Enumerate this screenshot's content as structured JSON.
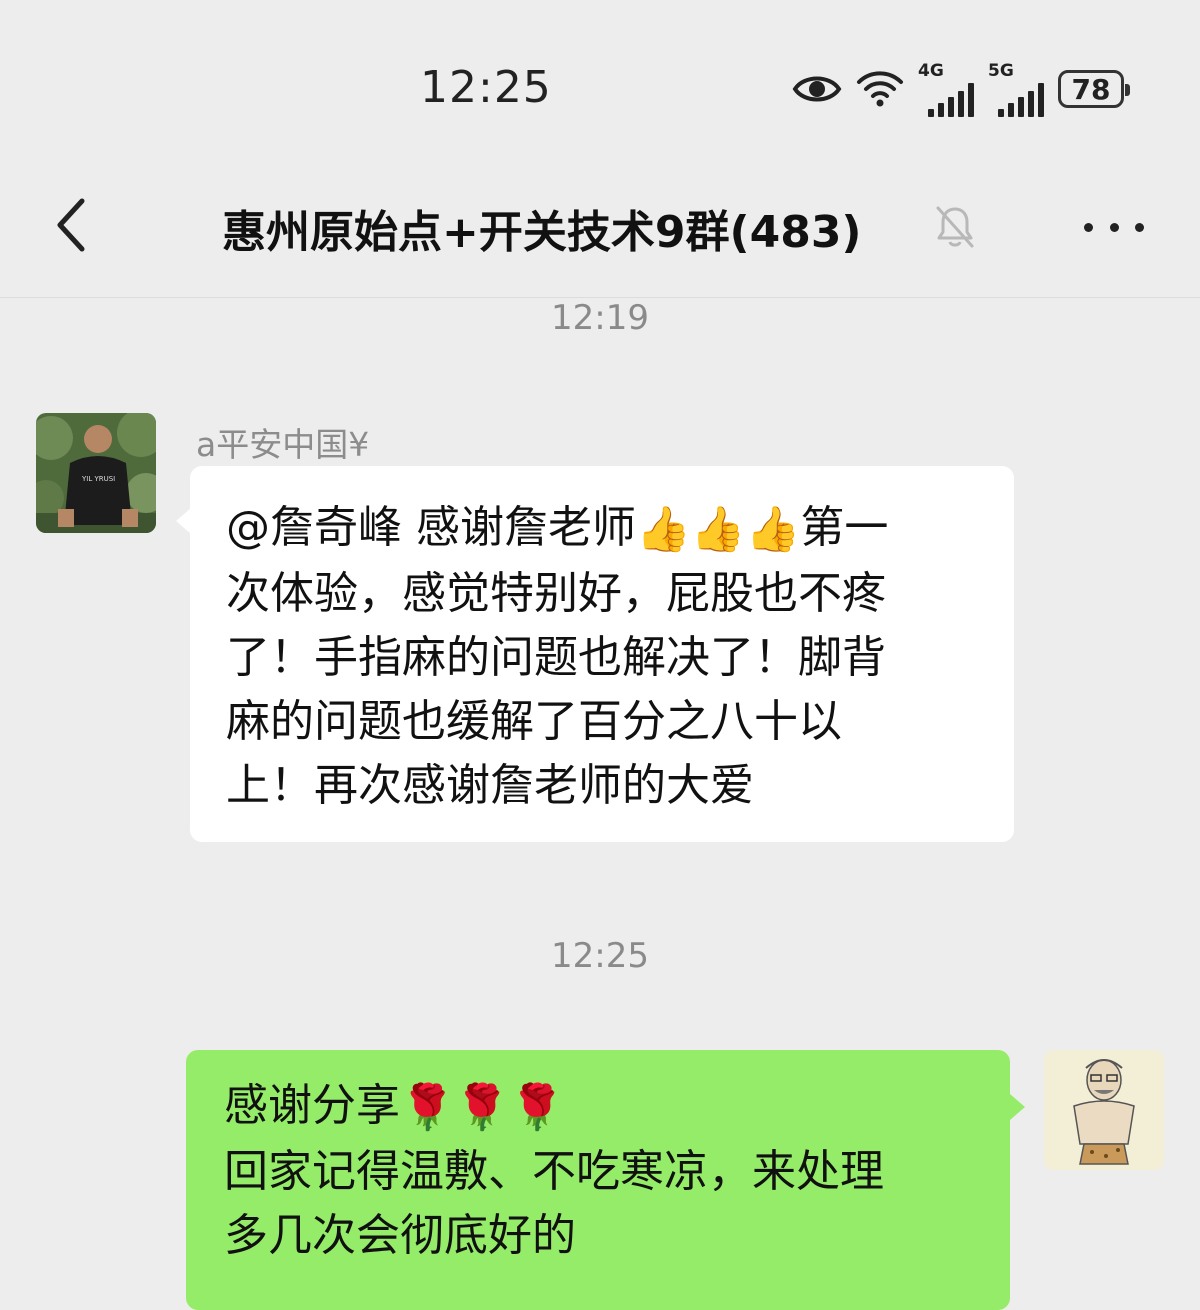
{
  "status_bar": {
    "time": "12:25",
    "icons": [
      "eye-icon",
      "wifi-icon",
      "signal-4g-icon",
      "signal-5g-icon",
      "battery-icon"
    ],
    "net1_label": "4G",
    "net2_label": "5G",
    "battery_level": "78"
  },
  "header": {
    "back_icon": "chevron-left-icon",
    "title": "惠州原始点+开关技术9群(483)",
    "mute_icon": "bell-muted-icon",
    "more_icon": "more-dots-icon"
  },
  "messages": [
    {
      "time": "12:19",
      "sender": "a平安中国¥",
      "lines": [
        {
          "text_a": "@詹奇峰  感谢詹老师",
          "emoji": "👍👍👍",
          "text_b": "第一"
        },
        {
          "text": "次体验，感觉特别好，屁股也不疼"
        },
        {
          "text": "了！手指麻的问题也解决了！脚背"
        },
        {
          "text": "麻的问题也缓解了百分之八十以"
        },
        {
          "text": "上！再次感谢詹老师的大爱"
        }
      ]
    },
    {
      "time": "12:25",
      "lines": [
        {
          "text_a": "感谢分享",
          "emoji": "🌹🌹🌹"
        },
        {
          "text": "回家记得温敷、不吃寒凉，来处理"
        },
        {
          "text": "多几次会彻底好的"
        }
      ]
    }
  ],
  "colors": {
    "background": "#ededed",
    "incoming_bubble": "#ffffff",
    "outgoing_bubble": "#95ec69"
  }
}
